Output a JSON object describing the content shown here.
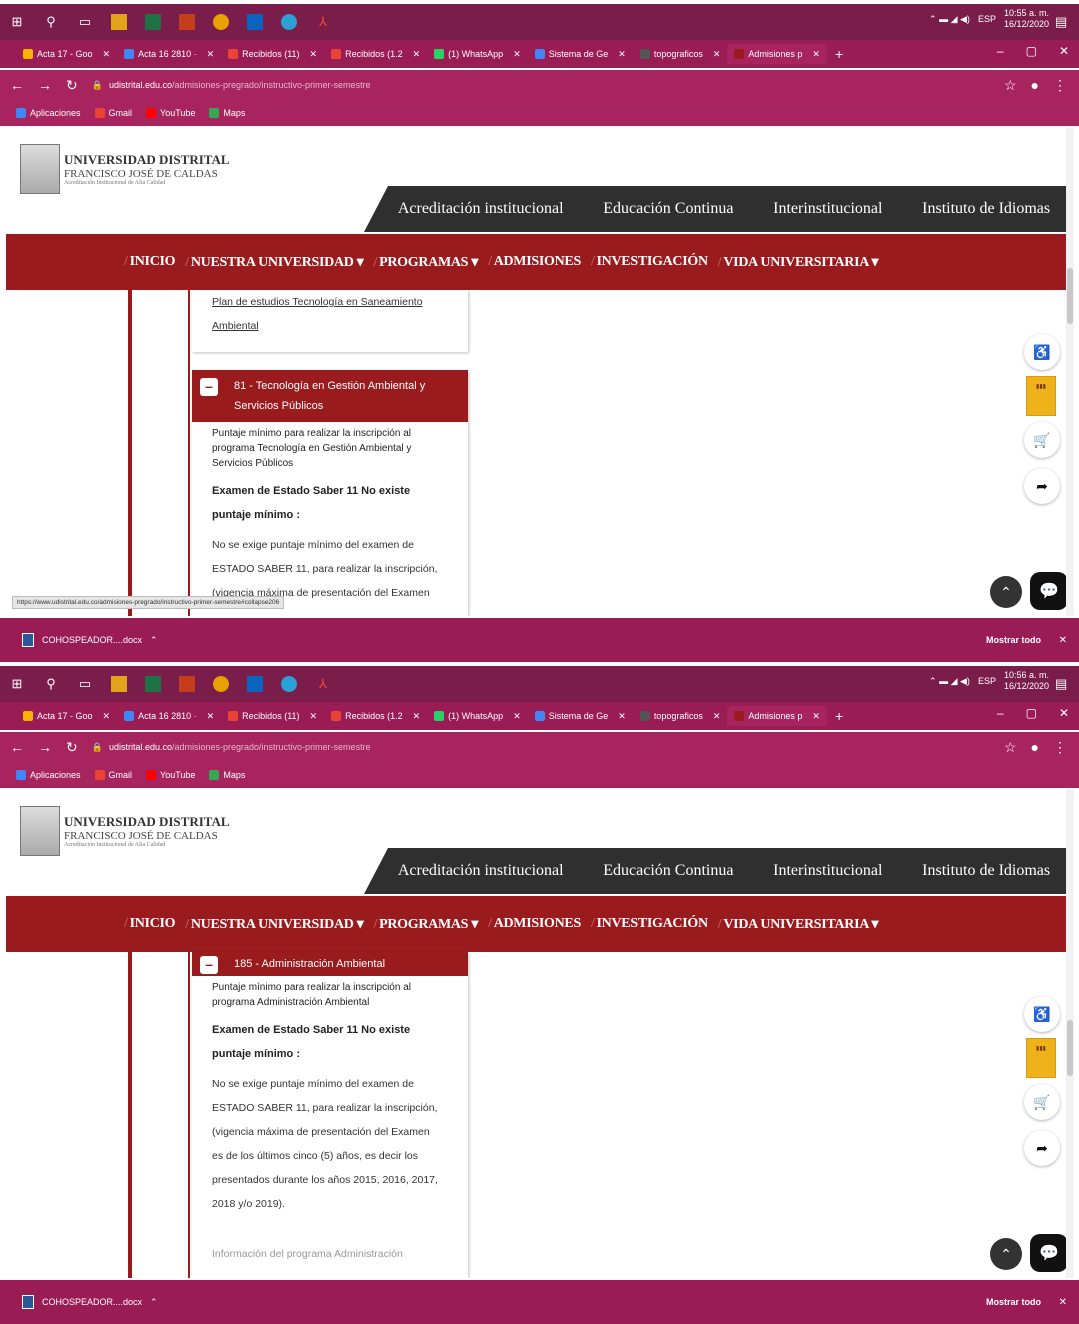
{
  "shots": [
    {
      "taskbar": {
        "clock_time": "10:55 a. m.",
        "clock_date": "16/12/2020",
        "lang": "ESP"
      },
      "panels": [
        {
          "title": "",
          "body": [
            "Plan de estudios Tecnología en Saneamiento",
            "Ambiental"
          ]
        },
        {
          "title": "81 - Tecnología en Gestión Ambiental y Servicios Públicos",
          "intro": "Puntaje mínimo para realizar la inscripción al programa Tecnología en Gestión Ambiental y Servicios Públicos",
          "exam_title": "Examen de Estado Saber 11 No existe puntaje mínimo :",
          "note": [
            "No se exige puntaje mínimo del examen de",
            "ESTADO SABER 11, para realizar la inscripción,",
            "(vigencia máxima de presentación del Examen"
          ]
        }
      ],
      "status_url": "https://www.udistrital.edu.co/admisiones-pregrado/instructivo-primer-semestre#collapse206"
    },
    {
      "taskbar": {
        "clock_time": "10:56 a. m.",
        "clock_date": "16/12/2020",
        "lang": "ESP"
      },
      "panels": [
        {
          "title": "185 - Administración Ambiental",
          "intro": "Puntaje mínimo para realizar la inscripción al programa Administración Ambiental",
          "exam_title": "Examen de Estado Saber 11 No existe puntaje mínimo :",
          "note": [
            "No se exige puntaje mínimo del examen de",
            "ESTADO SABER 11, para realizar la inscripción,",
            "(vigencia máxima de presentación del Examen",
            "es de los últimos cinco (5) años, es decir los",
            "presentados durante los años 2015, 2016, 2017,",
            "2018 y/o 2019)."
          ],
          "footer": "Información del programa Administración"
        }
      ]
    }
  ],
  "browser": {
    "tabs": [
      {
        "label": "Acta 17 - Goo",
        "color": "#f4b400"
      },
      {
        "label": "Acta 16 2810 ·",
        "color": "#4285f4"
      },
      {
        "label": "Recibidos (11)",
        "color": "#ea4335"
      },
      {
        "label": "Recibidos (1.2",
        "color": "#ea4335"
      },
      {
        "label": "(1) WhatsApp",
        "color": "#25d366"
      },
      {
        "label": "Sistema de Ge",
        "color": "#4285f4"
      },
      {
        "label": "topograficos",
        "color": "#555555"
      },
      {
        "label": "Admisiones p",
        "color": "#9a1b1e"
      }
    ],
    "url_domain": "udistrital.edu.co",
    "url_path": "/admisiones-pregrado/instructivo-primer-semestre",
    "bookmarks": [
      "Aplicaciones",
      "Gmail",
      "YouTube",
      "Maps"
    ]
  },
  "site": {
    "logo_line1": "UNIVERSIDAD DISTRITAL",
    "logo_line2": "FRANCISCO JOSÉ DE CALDAS",
    "logo_line3": "Acreditación Institucional de Alta Calidad",
    "topnav": [
      "Acreditación institucional",
      "Educación Continua",
      "Interinstitucional",
      "Instituto de Idiomas"
    ],
    "mainnav": [
      "INICIO",
      "NUESTRA UNIVERSIDAD ▾",
      "PROGRAMAS ▾",
      "ADMISIONES",
      "INVESTIGACIÓN",
      "VIDA UNIVERSITARIA ▾"
    ]
  },
  "downloads": {
    "file": "COHOSPEADOR....docx",
    "show_all": "Mostrar todo"
  },
  "colors": {
    "brand": "#9a1b1e",
    "chrome": "#a8245f",
    "taskbar": "#7a1d4a"
  }
}
